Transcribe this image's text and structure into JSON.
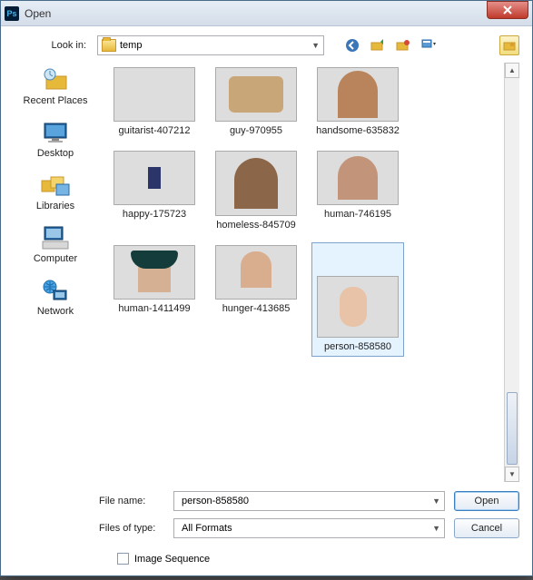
{
  "title": "Open",
  "lookin": {
    "label": "Look in:",
    "value": "temp"
  },
  "toolbar_icons": [
    "back-icon",
    "up-icon",
    "new-folder-icon",
    "view-menu-icon",
    "create-folder-icon"
  ],
  "places": [
    {
      "id": "recent",
      "label": "Recent Places"
    },
    {
      "id": "desktop",
      "label": "Desktop"
    },
    {
      "id": "libraries",
      "label": "Libraries"
    },
    {
      "id": "computer",
      "label": "Computer"
    },
    {
      "id": "network",
      "label": "Network"
    }
  ],
  "files": [
    {
      "label": "guitarist-407212",
      "selected": false
    },
    {
      "label": "guy-970955",
      "selected": false
    },
    {
      "label": "handsome-635832",
      "selected": false
    },
    {
      "label": "happy-175723",
      "selected": false
    },
    {
      "label": "homeless-845709",
      "selected": false
    },
    {
      "label": "human-746195",
      "selected": false
    },
    {
      "label": "human-1411499",
      "selected": false
    },
    {
      "label": "hunger-413685",
      "selected": false
    },
    {
      "label": "person-858580",
      "selected": true
    }
  ],
  "filename": {
    "label": "File name:",
    "value": "person-858580"
  },
  "filetype": {
    "label": "Files of type:",
    "value": "All Formats"
  },
  "buttons": {
    "open": "Open",
    "cancel": "Cancel"
  },
  "options": {
    "image_sequence": "Image Sequence"
  }
}
